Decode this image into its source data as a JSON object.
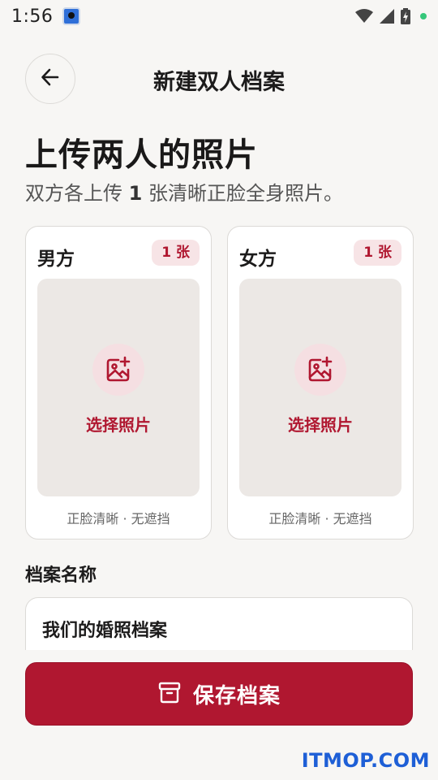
{
  "status_bar": {
    "time": "1:56",
    "icons": [
      "app-notification-icon",
      "wifi-icon",
      "signal-icon",
      "battery-charging-icon",
      "status-dot"
    ]
  },
  "header": {
    "back_icon": "arrow-left-icon",
    "title": "新建双人档案"
  },
  "intro": {
    "heading": "上传两人的照片",
    "sub_prefix": "双方各上传 ",
    "sub_count": "1",
    "sub_suffix": " 张清晰正脸全身照片。"
  },
  "cards": [
    {
      "title": "男方",
      "badge": "1 张",
      "pick_label": "选择照片",
      "hint": "正脸清晰 · 无遮挡",
      "icon": "add-photo-icon"
    },
    {
      "title": "女方",
      "badge": "1 张",
      "pick_label": "选择照片",
      "hint": "正脸清晰 · 无遮挡",
      "icon": "add-photo-icon"
    }
  ],
  "profile_name": {
    "label": "档案名称",
    "value": "我们的婚照档案"
  },
  "save_button": {
    "label": "保存档案",
    "icon": "archive-box-icon"
  },
  "watermark": "ITMOP.COM",
  "colors": {
    "accent": "#b01730",
    "background": "#f7f6f4",
    "badge_bg": "#f7e4e6",
    "dropzone_bg": "#ece8e5"
  }
}
